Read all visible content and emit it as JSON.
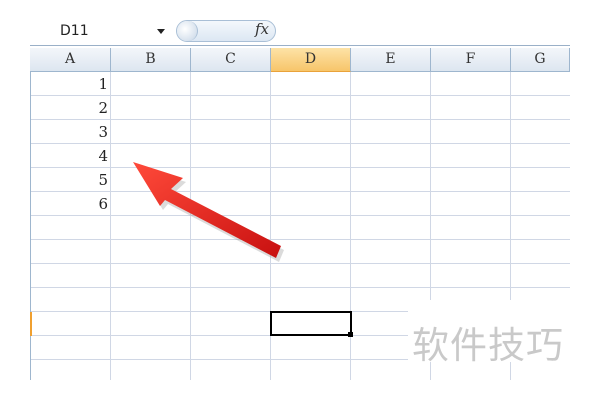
{
  "formula_bar": {
    "name_box_value": "D11",
    "fx_label": "fx",
    "formula_value": ""
  },
  "columns": [
    {
      "label": "A",
      "active": false
    },
    {
      "label": "B",
      "active": false
    },
    {
      "label": "C",
      "active": false
    },
    {
      "label": "D",
      "active": true
    },
    {
      "label": "E",
      "active": false
    },
    {
      "label": "F",
      "active": false
    },
    {
      "label": "G",
      "active": false
    }
  ],
  "cells": {
    "column_a_values": [
      "1",
      "2",
      "3",
      "4",
      "5",
      "6"
    ]
  },
  "selection": {
    "active_cell": "D11"
  },
  "annotation": {
    "arrow_color": "#e02020",
    "points_to": "A4"
  },
  "watermark": {
    "text": "软件技巧"
  },
  "colors": {
    "active_header": "#f7c56a",
    "gridline": "#d0d7e5",
    "header_border": "#9eb6ce"
  }
}
